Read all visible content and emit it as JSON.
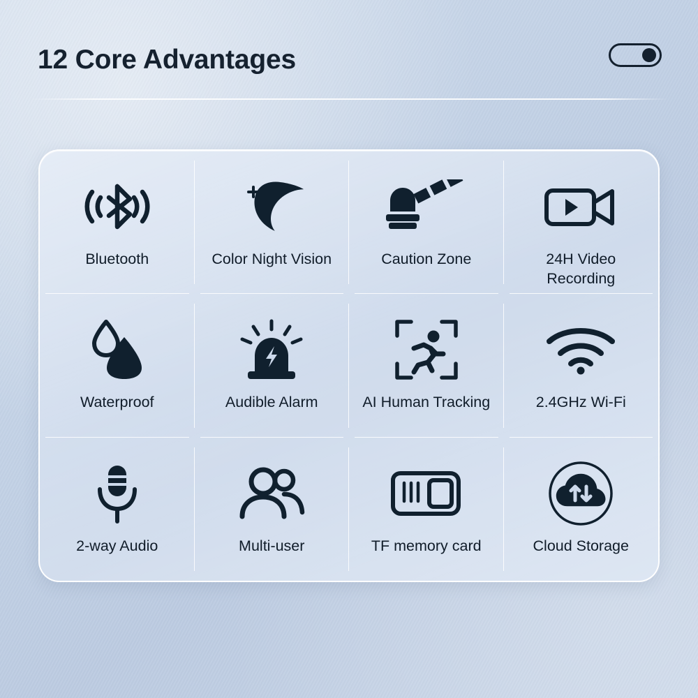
{
  "header": {
    "title": "12 Core Advantages",
    "toggle_name": "power-toggle",
    "toggle_state": "on"
  },
  "colors": {
    "background_top": "#cfdcec",
    "background_bottom": "#c9d6e8",
    "card_fill": "#cbd8ea",
    "icon": "#10202e",
    "text": "#101c29",
    "divider": "#ffffff"
  },
  "features": [
    {
      "icon": "bluetooth-icon",
      "label": "Bluetooth"
    },
    {
      "icon": "moon-stars-icon",
      "label": "Color Night Vision"
    },
    {
      "icon": "barrier-gate-icon",
      "label": "Caution Zone"
    },
    {
      "icon": "video-camera-icon",
      "label": "24H Video\nRecording"
    },
    {
      "icon": "water-drops-icon",
      "label": "Waterproof"
    },
    {
      "icon": "siren-alarm-icon",
      "label": "Audible Alarm"
    },
    {
      "icon": "human-tracking-icon",
      "label": "AI Human Tracking"
    },
    {
      "icon": "wifi-icon",
      "label": "2.4GHz Wi-Fi"
    },
    {
      "icon": "microphone-icon",
      "label": "2-way Audio"
    },
    {
      "icon": "multi-user-icon",
      "label": "Multi-user"
    },
    {
      "icon": "memory-card-icon",
      "label": "TF memory card"
    },
    {
      "icon": "cloud-storage-icon",
      "label": "Cloud Storage"
    }
  ]
}
